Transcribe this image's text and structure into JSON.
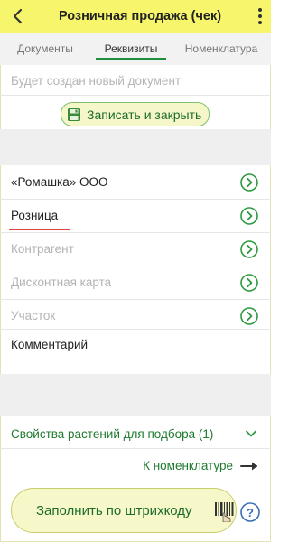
{
  "header": {
    "title": "Розничная продажа (чек)"
  },
  "tabs": [
    {
      "label": "Документы"
    },
    {
      "label": "Реквизиты",
      "active": true
    },
    {
      "label": "Номенклатура"
    }
  ],
  "form": {
    "new_document_placeholder": "Будет создан новый документ",
    "save_close_label": "Записать и закрыть",
    "fields": [
      {
        "value": "«Ромашка» ООО",
        "muted": false
      },
      {
        "value": "Розница",
        "muted": false
      },
      {
        "value": "Контрагент",
        "muted": true
      },
      {
        "value": "Дисконтная карта",
        "muted": true
      },
      {
        "value": "Участок",
        "muted": true
      },
      {
        "value": "Комментарий",
        "muted": false
      }
    ],
    "plant_props_label": "Свойства растений для подбора (1)",
    "to_nomenclature_label": "К номенклатуре",
    "fill_barcode_label": "Заполнить по штрихкоду",
    "help_label": "?"
  },
  "colors": {
    "header_bg": "#f6f56c",
    "accent_green": "#1e7a2e",
    "error_red": "#e04545"
  },
  "icons": {
    "back": "chevron-left-icon",
    "menu": "more-vertical-icon",
    "save": "floppy-disk-icon",
    "field_open": "chevron-right-circle-icon",
    "expand": "chevron-down-icon",
    "arrow": "arrow-right-icon",
    "barcode": "barcode-icon",
    "help": "help-circle-icon"
  }
}
